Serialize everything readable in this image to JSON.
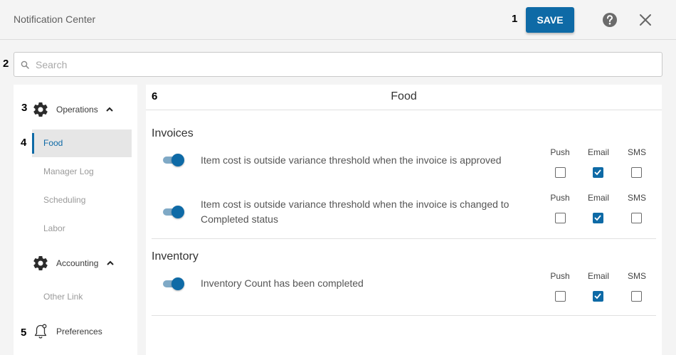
{
  "header": {
    "app_title": "Notification Center",
    "save_label": "SAVE",
    "marker_save": "1"
  },
  "search": {
    "marker": "2",
    "placeholder": "Search",
    "value": ""
  },
  "sidebar": {
    "groups": [
      {
        "marker": "3",
        "label": "Operations",
        "icon": "gear-icon",
        "expanded": true
      },
      {
        "marker": "",
        "label": "Accounting",
        "icon": "gear-icon",
        "expanded": true
      },
      {
        "marker": "5",
        "label": "Preferences",
        "icon": "bell-icon"
      }
    ],
    "operations_items": [
      {
        "marker": "4",
        "label": "Food",
        "active": true
      },
      {
        "label": "Manager Log"
      },
      {
        "label": "Scheduling"
      },
      {
        "label": "Labor"
      }
    ],
    "accounting_items": [
      {
        "label": "Other Link"
      }
    ]
  },
  "main": {
    "marker": "6",
    "title": "Food",
    "channel_headers": [
      "Push",
      "Email",
      "SMS"
    ],
    "sections": [
      {
        "title": "Invoices",
        "rows": [
          {
            "text": "Item cost is outside variance threshold when the invoice is approved",
            "enabled": true,
            "push": false,
            "email": true,
            "sms": false
          },
          {
            "text": "Item cost is outside variance threshold when the invoice is changed to Completed status",
            "enabled": true,
            "push": false,
            "email": true,
            "sms": false
          }
        ]
      },
      {
        "title": "Inventory",
        "rows": [
          {
            "text": "Inventory Count has been completed",
            "enabled": true,
            "push": false,
            "email": true,
            "sms": false
          }
        ]
      }
    ]
  },
  "colors": {
    "accent": "#0e6aa6",
    "background": "#f4f4f4"
  }
}
